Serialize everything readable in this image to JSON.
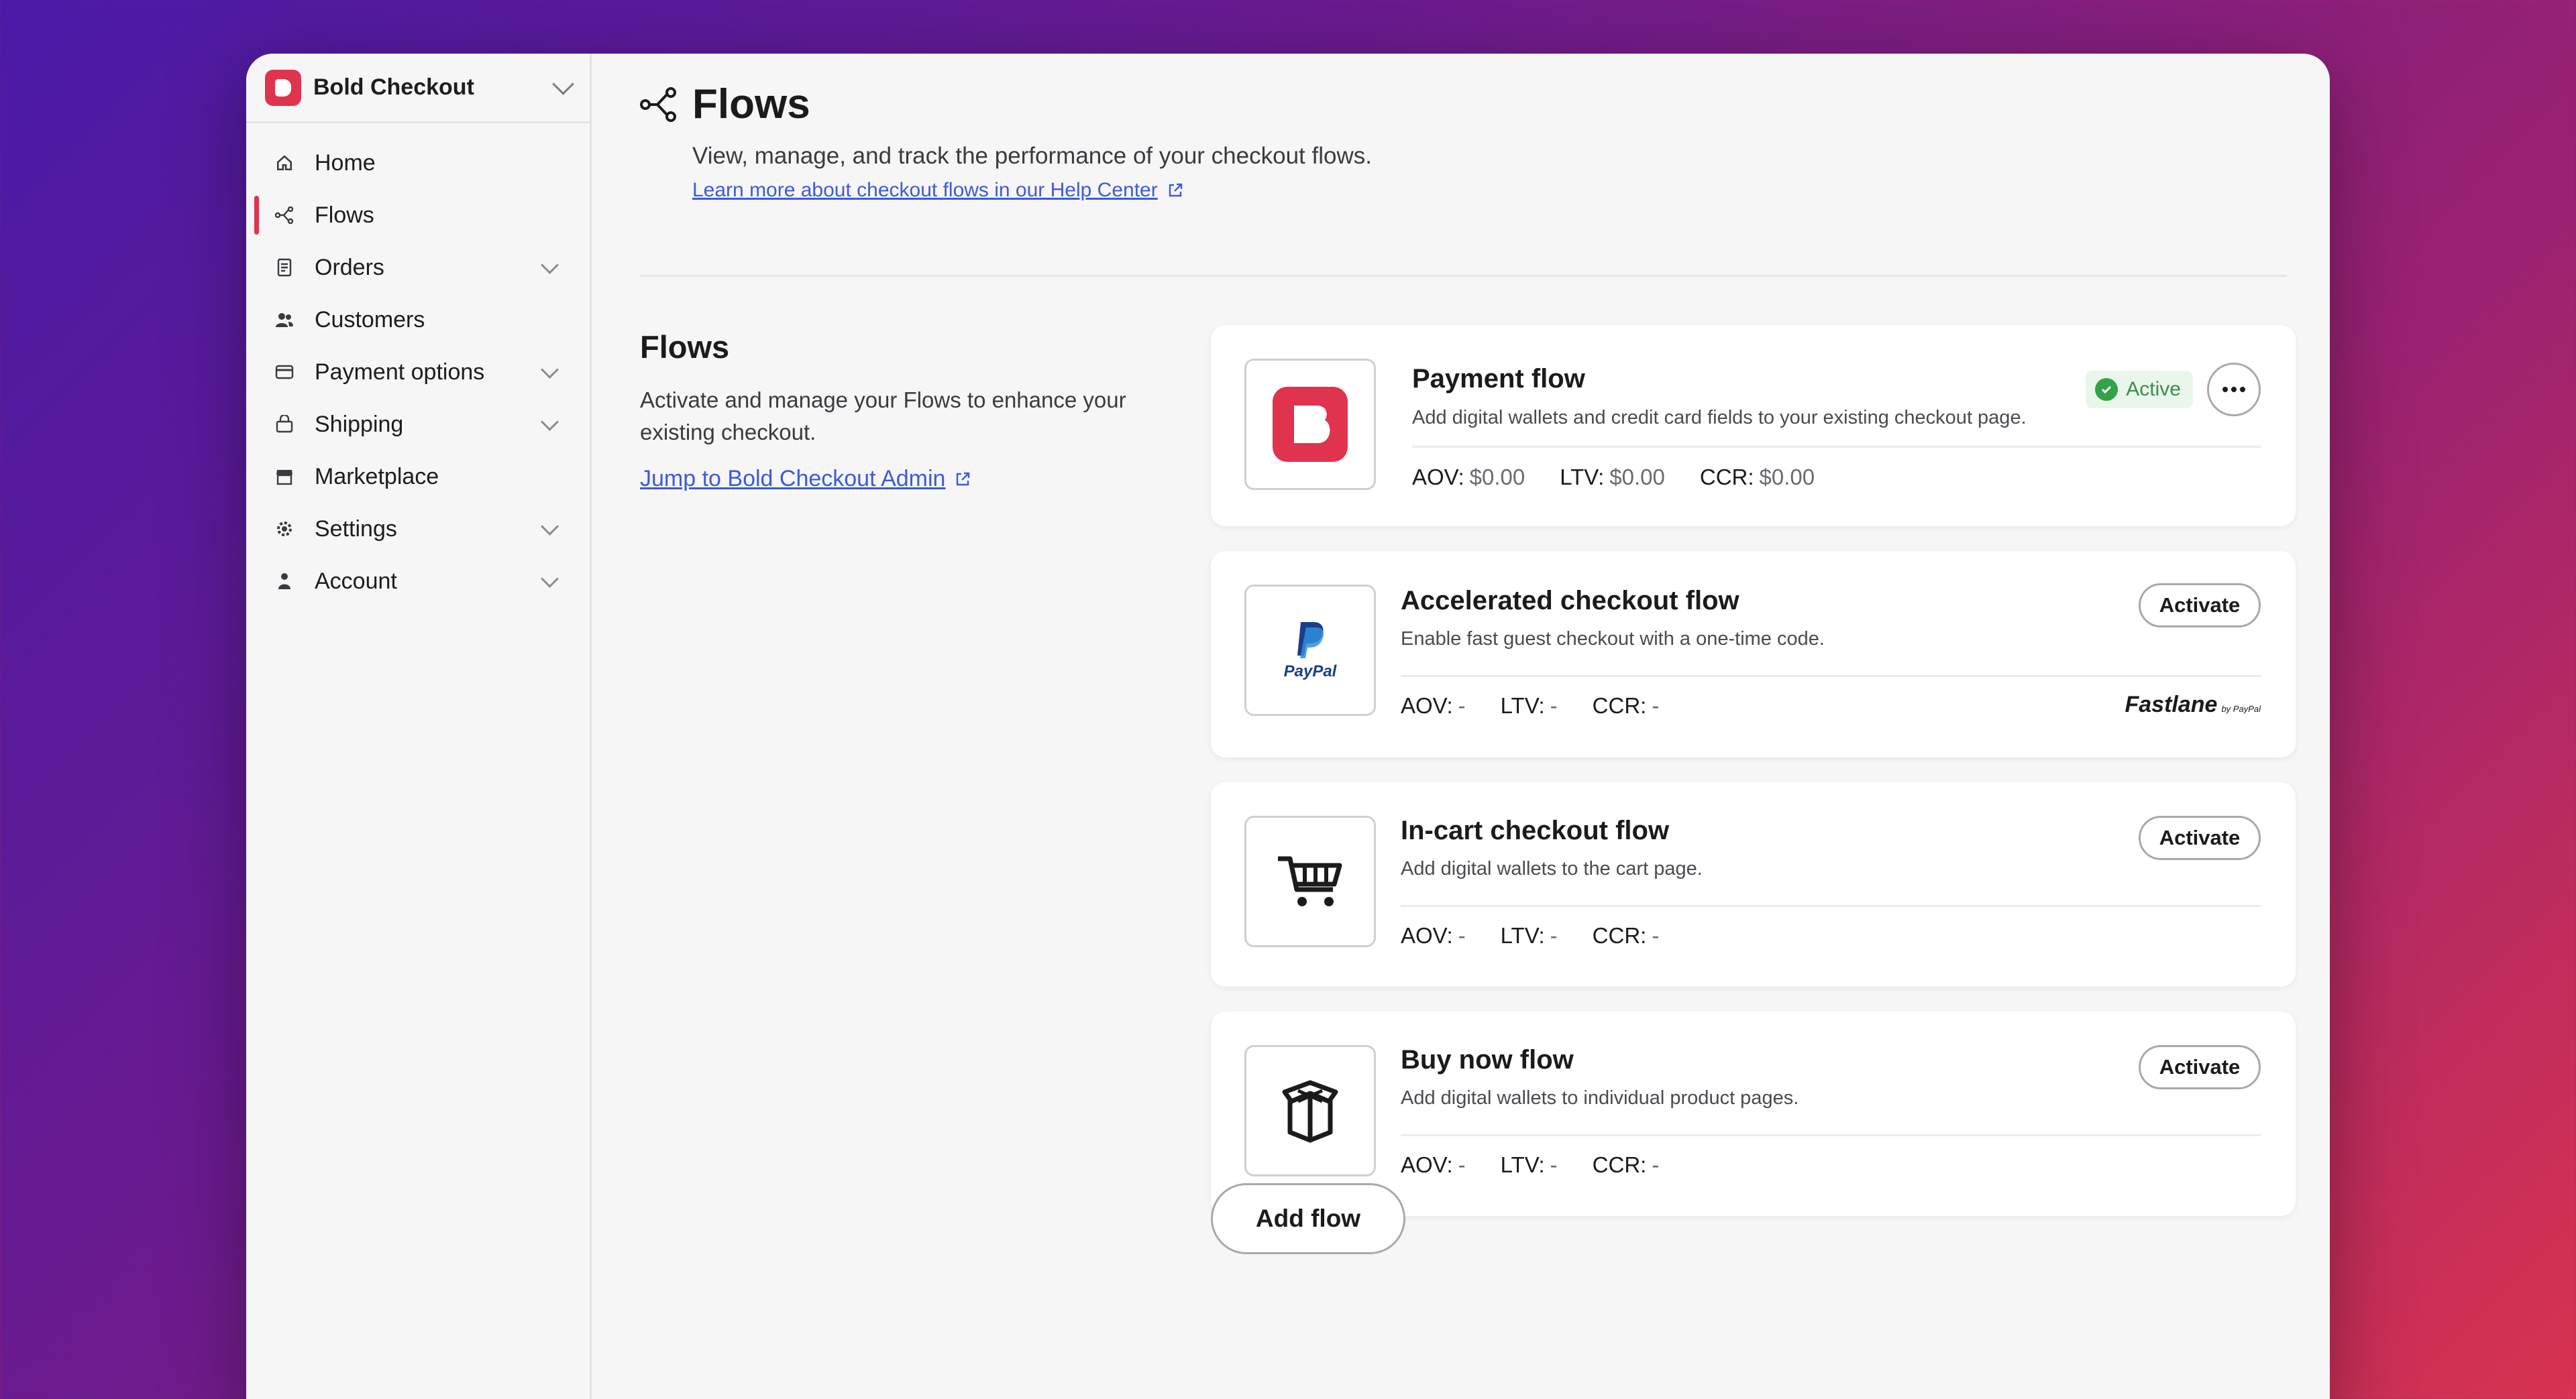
{
  "app": {
    "name": "Bold Checkout",
    "brand_color": "#e0334e"
  },
  "sidebar": {
    "items": [
      {
        "label": "Home",
        "icon": "home-icon",
        "has_chevron": false
      },
      {
        "label": "Flows",
        "icon": "flows-icon",
        "has_chevron": false,
        "active": true
      },
      {
        "label": "Orders",
        "icon": "orders-icon",
        "has_chevron": true
      },
      {
        "label": "Customers",
        "icon": "customers-icon",
        "has_chevron": false
      },
      {
        "label": "Payment options",
        "icon": "payment-options-icon",
        "has_chevron": true
      },
      {
        "label": "Shipping",
        "icon": "shipping-icon",
        "has_chevron": true
      },
      {
        "label": "Marketplace",
        "icon": "marketplace-icon",
        "has_chevron": false
      },
      {
        "label": "Settings",
        "icon": "settings-icon",
        "has_chevron": true
      },
      {
        "label": "Account",
        "icon": "account-icon",
        "has_chevron": true
      }
    ]
  },
  "header": {
    "title": "Flows",
    "subtitle": "View, manage, and track the performance of your checkout flows.",
    "help_link": "Learn more about checkout flows in our Help Center"
  },
  "intro": {
    "title": "Flows",
    "description": "Activate and manage your Flows to enhance your existing checkout.",
    "admin_link": "Jump to Bold Checkout Admin"
  },
  "flows": [
    {
      "title": "Payment flow",
      "description": "Add digital wallets and credit card fields to your existing checkout page.",
      "status": "Active",
      "aov_label": "AOV:",
      "aov": "$0.00",
      "ltv_label": "LTV:",
      "ltv": "$0.00",
      "ccr_label": "CCR:",
      "ccr": "$0.00",
      "logo": "bold-logo-icon"
    },
    {
      "title": "Accelerated checkout flow",
      "description": "Enable fast guest checkout with a one-time code.",
      "action": "Activate",
      "aov_label": "AOV:",
      "aov": "-",
      "ltv_label": "LTV:",
      "ltv": "-",
      "ccr_label": "CCR:",
      "ccr": "-",
      "logo": "paypal-logo-icon",
      "logo_text": "PayPal",
      "partner": "Fastlane",
      "partner_by": "by PayPal"
    },
    {
      "title": "In-cart checkout flow",
      "description": "Add digital wallets to the cart page.",
      "action": "Activate",
      "aov_label": "AOV:",
      "aov": "-",
      "ltv_label": "LTV:",
      "ltv": "-",
      "ccr_label": "CCR:",
      "ccr": "-",
      "logo": "cart-icon"
    },
    {
      "title": "Buy now flow",
      "description": "Add digital wallets to individual product pages.",
      "action": "Activate",
      "aov_label": "AOV:",
      "aov": "-",
      "ltv_label": "LTV:",
      "ltv": "-",
      "ccr_label": "CCR:",
      "ccr": "-",
      "logo": "gift-box-icon"
    }
  ],
  "add_flow_label": "Add flow"
}
